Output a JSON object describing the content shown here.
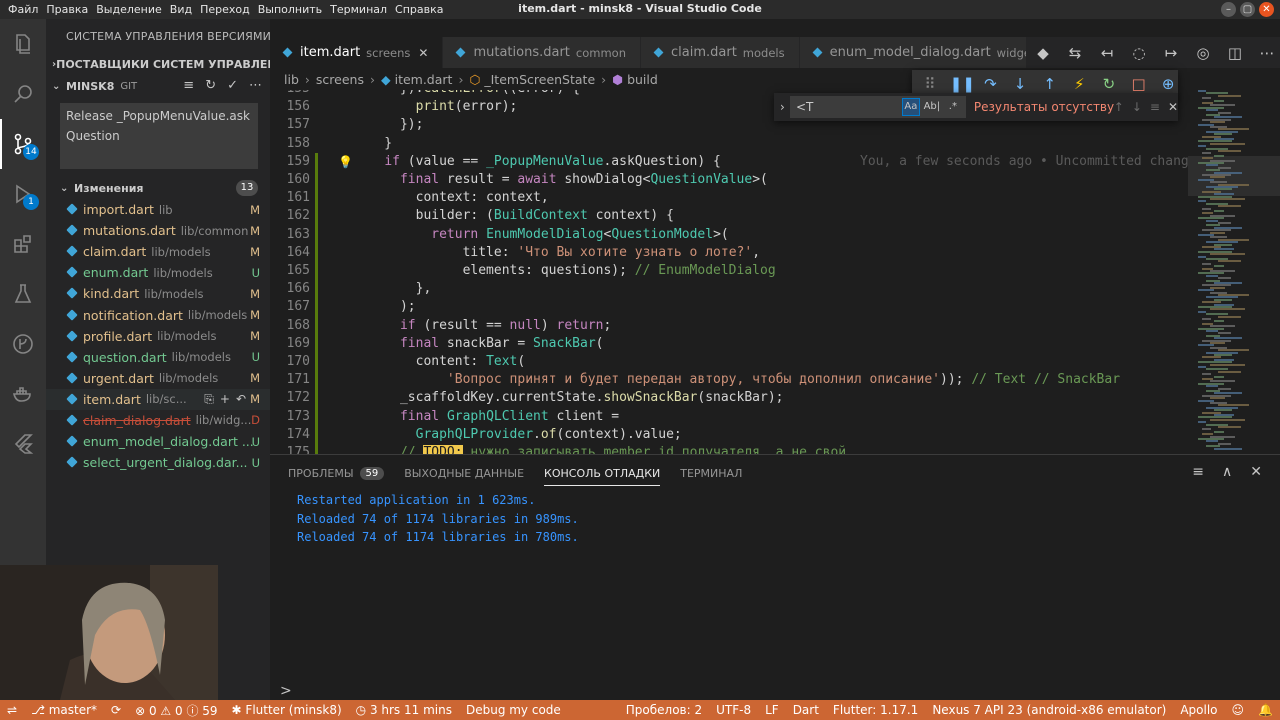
{
  "window": {
    "title": "item.dart - minsk8 - Visual Studio Code",
    "menu": [
      "Файл",
      "Правка",
      "Выделение",
      "Вид",
      "Переход",
      "Выполнить",
      "Терминал",
      "Справка"
    ],
    "controls": [
      "–",
      "▢",
      "✕"
    ]
  },
  "activity_bar": {
    "items": [
      {
        "name": "explorer-icon"
      },
      {
        "name": "search-icon"
      },
      {
        "name": "source-control-icon",
        "badge": "14"
      },
      {
        "name": "run-debug-icon",
        "badge": "1"
      },
      {
        "name": "extensions-icon"
      },
      {
        "name": "testing-icon"
      },
      {
        "name": "git-graph-icon"
      },
      {
        "name": "docker-icon"
      },
      {
        "name": "flutter-icon"
      }
    ]
  },
  "sidebar": {
    "title": "СИСТЕМА УПРАВЛЕНИЯ ВЕРСИЯМИ...",
    "providers_label": "ПОСТАВЩИКИ СИСТЕМ УПРАВЛЕН...",
    "repo_name": "MINSK8",
    "repo_type": "GIT",
    "repo_tools": [
      "≡",
      "↻",
      "✓",
      "⋯"
    ],
    "commit_message": "Release _PopupMenuValue.askQuestion",
    "changes_label": "Изменения",
    "changes_count": "13",
    "files": [
      {
        "name": "import.dart",
        "path": "lib",
        "status": "M"
      },
      {
        "name": "mutations.dart",
        "path": "lib/common",
        "status": "M"
      },
      {
        "name": "claim.dart",
        "path": "lib/models",
        "status": "M"
      },
      {
        "name": "enum.dart",
        "path": "lib/models",
        "status": "U"
      },
      {
        "name": "kind.dart",
        "path": "lib/models",
        "status": "M"
      },
      {
        "name": "notification.dart",
        "path": "lib/models",
        "status": "M"
      },
      {
        "name": "profile.dart",
        "path": "lib/models",
        "status": "M"
      },
      {
        "name": "question.dart",
        "path": "lib/models",
        "status": "U"
      },
      {
        "name": "urgent.dart",
        "path": "lib/models",
        "status": "M"
      },
      {
        "name": "item.dart",
        "path": "lib/sc...",
        "status": "M"
      },
      {
        "name": "claim_dialog.dart",
        "path": "lib/widg...",
        "status": "D"
      },
      {
        "name": "enum_model_dialog.dart ...",
        "path": "",
        "status": "U"
      },
      {
        "name": "select_urgent_dialog.dar...",
        "path": "",
        "status": "U"
      }
    ]
  },
  "tabs": [
    {
      "label": "item.dart",
      "desc": "screens",
      "active": true
    },
    {
      "label": "mutations.dart",
      "desc": "common",
      "active": false
    },
    {
      "label": "claim.dart",
      "desc": "models",
      "active": false
    },
    {
      "label": "enum_model_dialog.dart",
      "desc": "widgets",
      "active": false
    }
  ],
  "editor_actions": [
    "◆",
    "⇆",
    "↤",
    "◌",
    "↦",
    "◎",
    "◫",
    "⋯"
  ],
  "breadcrumb": [
    "lib",
    "screens",
    "item.dart",
    "_ItemScreenState",
    "build"
  ],
  "debug_toolbar": [
    "⠿",
    "❚❚",
    "↷",
    "↓",
    "↑",
    "⚡",
    "↻",
    "□",
    "⊕"
  ],
  "find": {
    "query": "<T",
    "options": [
      "Aa",
      "Ab|",
      ".*"
    ],
    "result": "Результаты отсутствуют",
    "buttons": [
      "↑",
      "↓",
      "≡",
      "✕"
    ]
  },
  "code": {
    "blame": "You, a few seconds ago • Uncommitted changes",
    "lines": [
      {
        "n": "155",
        "t": "      }).catchError((error) {"
      },
      {
        "n": "156",
        "t": "        print(error);"
      },
      {
        "n": "157",
        "t": "      });"
      },
      {
        "n": "158",
        "t": "    }"
      },
      {
        "n": "159",
        "t": "    if (value == _PopupMenuValue.askQuestion) {"
      },
      {
        "n": "160",
        "t": "      final result = await showDialog<QuestionValue>("
      },
      {
        "n": "161",
        "t": "        context: context,"
      },
      {
        "n": "162",
        "t": "        builder: (BuildContext context) {"
      },
      {
        "n": "163",
        "t": "          return EnumModelDialog<QuestionModel>("
      },
      {
        "n": "164",
        "t": "              title: 'Что Вы хотите узнать о лоте?',"
      },
      {
        "n": "165",
        "t": "              elements: questions); // EnumModelDialog"
      },
      {
        "n": "166",
        "t": "        },"
      },
      {
        "n": "167",
        "t": "      );"
      },
      {
        "n": "168",
        "t": "      if (result == null) return;"
      },
      {
        "n": "169",
        "t": "      final snackBar = SnackBar("
      },
      {
        "n": "170",
        "t": "        content: Text("
      },
      {
        "n": "171",
        "t": "            'Вопрос принят и будет передан автору, чтобы дополнил описание')); // Text // SnackBar"
      },
      {
        "n": "172",
        "t": "      _scaffoldKey.currentState.showSnackBar(snackBar);"
      },
      {
        "n": "173",
        "t": "      final GraphQLClient client ="
      },
      {
        "n": "174",
        "t": "        GraphQLProvider.of(context).value;"
      },
      {
        "n": "175",
        "t": "      // TODO: нужно записывать member.id получателя, а не свой"
      }
    ]
  },
  "panel": {
    "tabs": [
      {
        "label": "ПРОБЛЕМЫ",
        "count": "59"
      },
      {
        "label": "ВЫХОДНЫЕ ДАННЫЕ"
      },
      {
        "label": "КОНСОЛЬ ОТЛАДКИ",
        "active": true
      },
      {
        "label": "ТЕРМИНАЛ"
      }
    ],
    "actions": [
      "≡",
      "∧",
      "✕"
    ],
    "console": [
      "Restarted application in 1 623ms.",
      "Reloaded 74 of 1174 libraries in 989ms.",
      "Reloaded 74 of 1174 libraries in 780ms."
    ],
    "prompt": ">"
  },
  "statusbar": {
    "color": "#cc6633",
    "branch": "master*",
    "sync": "⟳",
    "problems": "⊗ 0 ⚠ 0 ⓘ 59",
    "flutter": "Flutter (minsk8)",
    "timer": "3 hrs 11 mins",
    "debug": "Debug my code",
    "spaces": "Пробелов: 2",
    "encoding": "UTF-8",
    "eol": "LF",
    "language": "Dart",
    "flutter_version": "Flutter: 1.17.1",
    "device": "Nexus 7 API 23 (android-x86 emulator)",
    "apollo": "Apollo"
  }
}
